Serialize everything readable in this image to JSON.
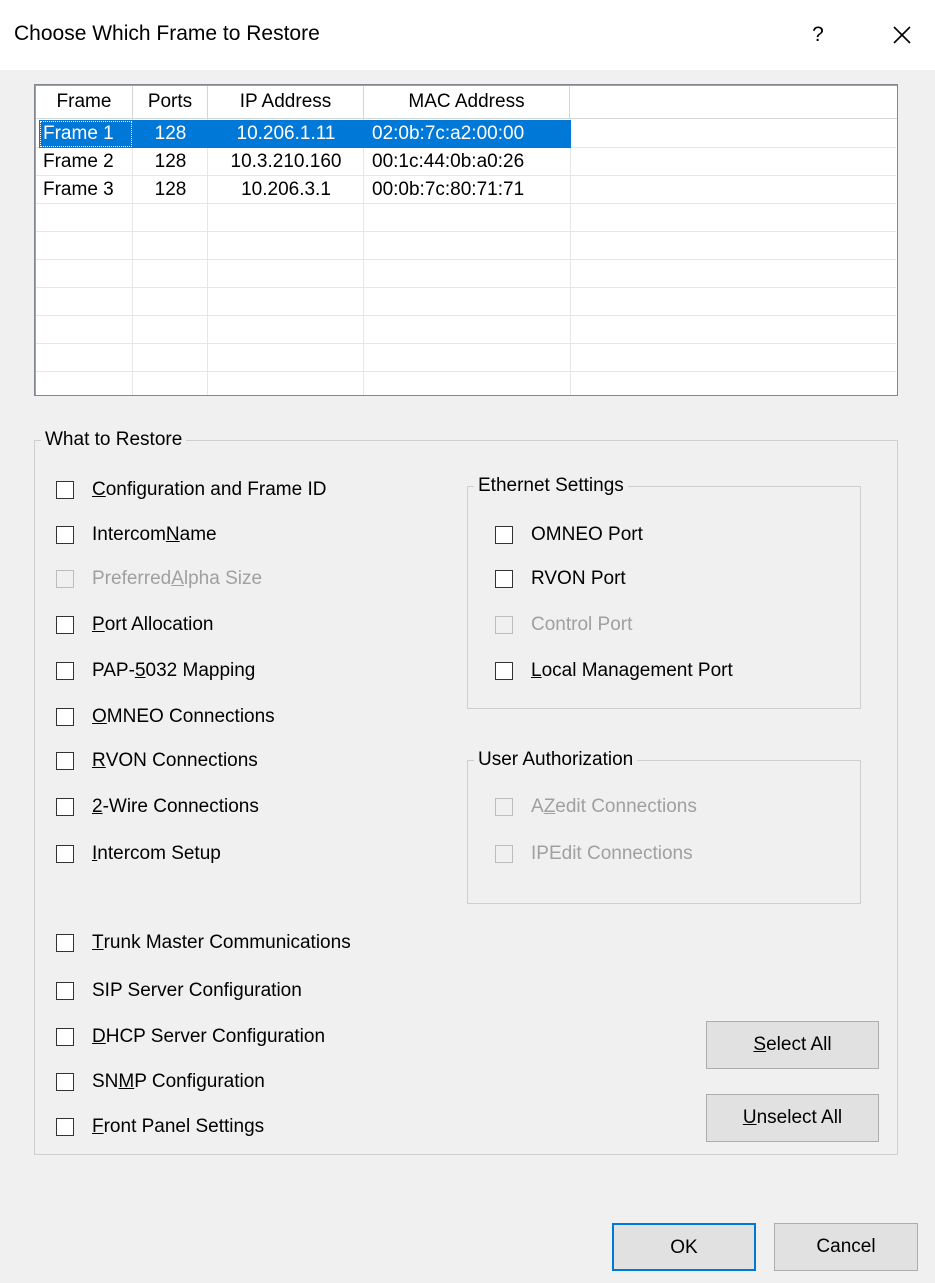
{
  "window": {
    "title": "Choose Which Frame to Restore",
    "help_glyph": "?",
    "close_icon": "close-icon"
  },
  "frames_table": {
    "columns": [
      "Frame",
      "Ports",
      "IP Address",
      "MAC Address"
    ],
    "rows": [
      {
        "frame": "Frame 1",
        "ports": "128",
        "ip": "10.206.1.11",
        "mac": "02:0b:7c:a2:00:00",
        "selected": true
      },
      {
        "frame": "Frame 2",
        "ports": "128",
        "ip": "10.3.210.160",
        "mac": "00:1c:44:0b:a0:26",
        "selected": false
      },
      {
        "frame": "Frame 3",
        "ports": "128",
        "ip": "10.206.3.1",
        "mac": "00:0b:7c:80:71:71",
        "selected": false
      }
    ],
    "selection_color": "#0078d7"
  },
  "what_to_restore": {
    "label": "What to Restore",
    "options": [
      {
        "pre": "",
        "u": "C",
        "post": "onfiguration and Frame ID",
        "checked": false,
        "enabled": true
      },
      {
        "pre": "Intercom ",
        "u": "N",
        "post": "ame",
        "checked": false,
        "enabled": true
      },
      {
        "pre": "Preferred ",
        "u": "A",
        "post": "lpha Size",
        "checked": false,
        "enabled": false
      },
      {
        "pre": "",
        "u": "P",
        "post": "ort Allocation",
        "checked": false,
        "enabled": true
      },
      {
        "pre": "PAP-",
        "u": "5",
        "post": "032 Mapping",
        "checked": false,
        "enabled": true
      },
      {
        "pre": "",
        "u": "O",
        "post": "MNEO Connections",
        "checked": false,
        "enabled": true
      },
      {
        "pre": "",
        "u": "R",
        "post": "VON Connections",
        "checked": false,
        "enabled": true
      },
      {
        "pre": "",
        "u": "2",
        "post": "-Wire Connections",
        "checked": false,
        "enabled": true
      },
      {
        "pre": "",
        "u": "I",
        "post": "ntercom Setup",
        "checked": false,
        "enabled": true
      },
      {
        "pre": "",
        "u": "T",
        "post": "runk Master Communications",
        "checked": false,
        "enabled": true
      },
      {
        "pre": "SIP Server Configuration",
        "u": "",
        "post": "",
        "checked": false,
        "enabled": true
      },
      {
        "pre": "",
        "u": "D",
        "post": "HCP Server Configuration",
        "checked": false,
        "enabled": true
      },
      {
        "pre": "SN",
        "u": "M",
        "post": "P Configuration",
        "checked": false,
        "enabled": true
      },
      {
        "pre": "",
        "u": "F",
        "post": "ront Panel Settings",
        "checked": false,
        "enabled": true
      }
    ]
  },
  "ethernet_settings": {
    "label": "Ethernet Settings",
    "options": [
      {
        "pre": "OMNEO Port",
        "u": "",
        "post": "",
        "checked": false,
        "enabled": true
      },
      {
        "pre": "RVON Port",
        "u": "",
        "post": "",
        "checked": false,
        "enabled": true
      },
      {
        "pre": "Control Port",
        "u": "",
        "post": "",
        "checked": false,
        "enabled": false
      },
      {
        "pre": "",
        "u": "L",
        "post": "ocal Management Port",
        "checked": false,
        "enabled": true
      }
    ]
  },
  "user_authorization": {
    "label": "User Authorization",
    "options": [
      {
        "pre": "A",
        "u": "Z",
        "post": "edit Connections",
        "checked": false,
        "enabled": false
      },
      {
        "pre": "IPEdit Connections",
        "u": "",
        "post": "",
        "checked": false,
        "enabled": false
      }
    ]
  },
  "buttons": {
    "select_all": {
      "pre": "",
      "u": "S",
      "post": "elect All"
    },
    "unselect_all": {
      "pre": "",
      "u": "U",
      "post": "nselect All"
    },
    "ok": "OK",
    "cancel": "Cancel"
  }
}
